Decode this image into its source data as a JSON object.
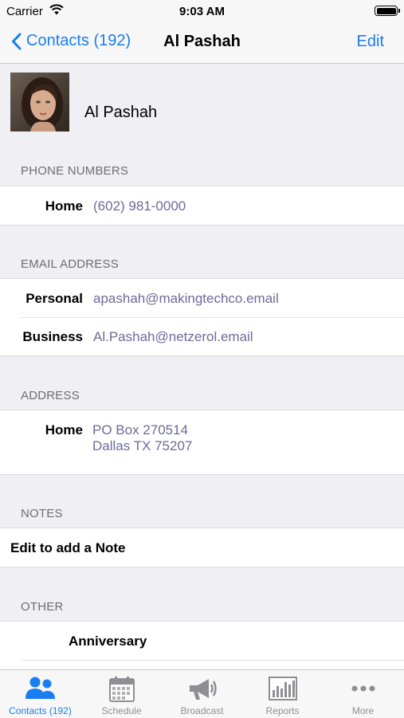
{
  "status": {
    "carrier": "Carrier",
    "time": "9:03 AM"
  },
  "nav": {
    "back_label": "Contacts (192)",
    "title": "Al Pashah",
    "edit_label": "Edit"
  },
  "contact": {
    "name": "Al Pashah"
  },
  "phones": {
    "header": "PHONE NUMBERS",
    "items": [
      {
        "label": "Home",
        "value": "(602) 981-0000"
      }
    ]
  },
  "emails": {
    "header": "EMAIL ADDRESS",
    "items": [
      {
        "label": "Personal",
        "value": "apashah@makingtechco.email"
      },
      {
        "label": "Business",
        "value": "Al.Pashah@netzerol.email"
      }
    ]
  },
  "address": {
    "header": "ADDRESS",
    "label": "Home",
    "line1": "PO Box 270514",
    "line2": "Dallas TX 75207"
  },
  "notes": {
    "header": "NOTES",
    "text": "Edit to add a Note"
  },
  "other": {
    "header": "OTHER",
    "items": [
      {
        "label": "Anniversary"
      }
    ]
  },
  "tabs": [
    {
      "label": "Contacts (192)",
      "icon": "contacts-icon",
      "active": true
    },
    {
      "label": "Schedule",
      "icon": "calendar-icon",
      "active": false
    },
    {
      "label": "Broadcast",
      "icon": "megaphone-icon",
      "active": false
    },
    {
      "label": "Reports",
      "icon": "bar-chart-icon",
      "active": false
    },
    {
      "label": "More",
      "icon": "more-icon",
      "active": false
    }
  ],
  "colors": {
    "accent": "#1a7ef0",
    "value_text": "#6b6b9a",
    "inactive_tab": "#8e8e93",
    "background": "#efeff4"
  }
}
